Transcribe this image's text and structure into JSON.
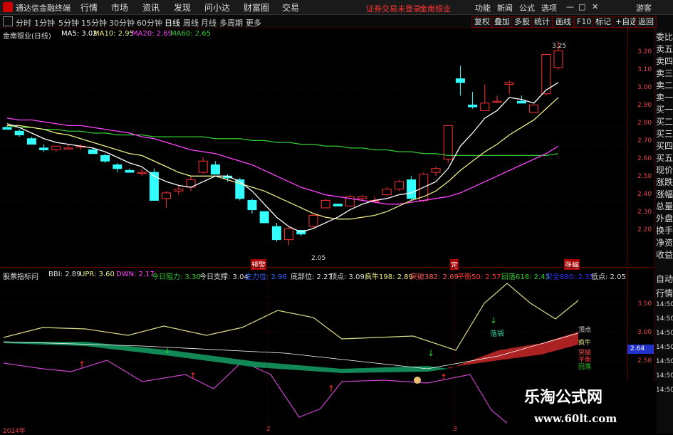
{
  "titlebar": {
    "app_title": "通达信金融终端",
    "menus": [
      "行情",
      "市场",
      "资讯",
      "发现",
      "问小达",
      "财富圈",
      "交易"
    ],
    "alert": "证券交易未登录",
    "stock_name": "金南银业",
    "right_menus": [
      "功能",
      "新闻",
      "公式",
      "选项"
    ],
    "window_controls": [
      "—",
      "□",
      "✕"
    ]
  },
  "toolbar": {
    "periods": [
      "分时",
      "1分钟",
      "5分钟",
      "15分钟",
      "30分钟",
      "60分钟",
      "日线",
      "周线",
      "月线",
      "多周期",
      "更多"
    ],
    "active_period": "日线",
    "right_buttons": [
      "复权",
      "叠加",
      "多股",
      "统计",
      "画线",
      "F10",
      "标记",
      "+自选",
      "返回"
    ],
    "far_right": "游客"
  },
  "main_legend": {
    "name": "金南银业(日线)",
    "ma5": "MA5: 3.02",
    "ma10": "MA10: 2.95",
    "ma20": "MA20: 2.69",
    "ma60": "MA60: 2.65"
  },
  "main_axis": [
    "3.20",
    "3.10",
    "3.00",
    "2.90",
    "2.80",
    "2.70",
    "2.60",
    "2.50",
    "2.40",
    "2.30",
    "2.20"
  ],
  "annotations": {
    "high": "3.25",
    "low": "2.05",
    "tag1": "预警",
    "tag2": "定",
    "tag3": "涨幅"
  },
  "sub_legend": {
    "name": "股票指标问",
    "bbi": "BBI: 2.89",
    "upr": "UPR: 3.60",
    "dwn": "DWN: 2.17",
    "resist": "今日阻力: 3.30",
    "support": "今日支撑: 3.04",
    "zhuli": "主力位: 2.96",
    "bottom": "底部位: 2.27",
    "top": "顶点: 3.09",
    "crazy": "疯牛198: 2.89",
    "break": "突破382: 2.69",
    "balance": "平衡50: 2.57",
    "pullback": "回落618: 2.45",
    "safe": "安全880: 2.35",
    "lowpt": "低点: 2.05"
  },
  "sub_axis": [
    "3.50",
    "3.00",
    "2.50"
  ],
  "sub_labels": {
    "topline": "顶点",
    "crazy": "疯牛",
    "l1": "突破",
    "l2": "平衡",
    "l3": "回落",
    "fall": "落袋",
    "current": "2.64"
  },
  "time_axis": [
    "2024年",
    "2",
    "3"
  ],
  "side_panel": [
    "委比",
    "卖五",
    "卖四",
    "卖三",
    "卖二",
    "卖一",
    "买一",
    "买二",
    "买三",
    "买四",
    "买五",
    "现价",
    "涨跌",
    "涨幅",
    "总量",
    "外盘",
    "换手",
    "净资",
    "收益"
  ],
  "side_panel2": [
    "自动",
    "行情",
    "14:50",
    "14:50",
    "14:50",
    "14:50",
    "14:50",
    "14:50",
    "14:50"
  ],
  "watermark": {
    "line1": "乐淘公式网",
    "line2": "www.60lt.com"
  },
  "colors": {
    "up": "#ff3333",
    "down": "#33ffff",
    "ma5": "#ffffff",
    "ma10": "#eeee88",
    "ma20": "#ff44ff",
    "ma60": "#33cc33",
    "bg": "#000000"
  },
  "chart_data": {
    "type": "candlestick",
    "candles": [
      [
        2.79,
        2.8,
        2.78,
        2.78
      ],
      [
        2.77,
        2.78,
        2.74,
        2.75
      ],
      [
        2.73,
        2.74,
        2.7,
        2.7
      ],
      [
        2.68,
        2.7,
        2.66,
        2.67
      ],
      [
        2.67,
        2.69,
        2.66,
        2.69
      ],
      [
        2.68,
        2.7,
        2.67,
        2.68
      ],
      [
        2.69,
        2.7,
        2.67,
        2.69
      ],
      [
        2.67,
        2.68,
        2.65,
        2.65
      ],
      [
        2.64,
        2.65,
        2.6,
        2.61
      ],
      [
        2.59,
        2.6,
        2.55,
        2.57
      ],
      [
        2.56,
        2.57,
        2.55,
        2.55
      ],
      [
        2.55,
        2.57,
        2.53,
        2.55
      ],
      [
        2.55,
        2.57,
        2.4,
        2.4
      ],
      [
        2.41,
        2.45,
        2.36,
        2.44
      ],
      [
        2.45,
        2.48,
        2.43,
        2.46
      ],
      [
        2.47,
        2.53,
        2.45,
        2.51
      ],
      [
        2.55,
        2.63,
        2.54,
        2.61
      ],
      [
        2.59,
        2.61,
        2.54,
        2.54
      ],
      [
        2.53,
        2.54,
        2.5,
        2.52
      ],
      [
        2.51,
        2.52,
        2.4,
        2.41
      ],
      [
        2.4,
        2.41,
        2.33,
        2.35
      ],
      [
        2.34,
        2.34,
        2.28,
        2.28
      ],
      [
        2.26,
        2.28,
        2.18,
        2.19
      ],
      [
        2.19,
        2.26,
        2.16,
        2.25
      ],
      [
        2.24,
        2.24,
        2.21,
        2.22
      ],
      [
        2.26,
        2.33,
        2.25,
        2.32
      ],
      [
        2.36,
        2.41,
        2.36,
        2.4
      ],
      [
        2.38,
        2.38,
        2.37,
        2.37
      ],
      [
        2.37,
        2.43,
        2.37,
        2.42
      ],
      [
        2.41,
        2.43,
        2.4,
        2.42
      ],
      [
        2.4,
        2.42,
        2.39,
        2.4
      ],
      [
        2.43,
        2.47,
        2.42,
        2.46
      ],
      [
        2.46,
        2.51,
        2.45,
        2.5
      ],
      [
        2.51,
        2.53,
        2.4,
        2.41
      ],
      [
        2.4,
        2.55,
        2.39,
        2.54
      ],
      [
        2.55,
        2.58,
        2.53,
        2.57
      ],
      [
        2.62,
        2.8,
        2.6,
        2.8
      ],
      [
        3.05,
        3.12,
        2.96,
        3.03
      ],
      [
        2.91,
        2.98,
        2.89,
        2.9
      ],
      [
        2.88,
        3.02,
        2.88,
        2.92
      ],
      [
        2.93,
        2.96,
        2.92,
        2.93
      ],
      [
        3.02,
        3.04,
        2.97,
        3.03
      ],
      [
        2.93,
        2.96,
        2.92,
        2.92
      ],
      [
        2.87,
        2.91,
        2.87,
        2.91
      ],
      [
        2.97,
        3.18,
        2.96,
        3.18
      ],
      [
        3.11,
        3.25,
        3.1,
        3.2
      ]
    ],
    "ma5": [
      2.81,
      2.79,
      2.76,
      2.73,
      2.71,
      2.7,
      2.69,
      2.68,
      2.66,
      2.63,
      2.6,
      2.58,
      2.53,
      2.5,
      2.48,
      2.47,
      2.5,
      2.53,
      2.53,
      2.5,
      2.45,
      2.38,
      2.31,
      2.26,
      2.23,
      2.25,
      2.28,
      2.31,
      2.35,
      2.38,
      2.4,
      2.41,
      2.43,
      2.44,
      2.47,
      2.5,
      2.57,
      2.69,
      2.76,
      2.84,
      2.88,
      2.95,
      2.94,
      2.92,
      2.99,
      3.03
    ],
    "ma10": [
      2.8,
      2.8,
      2.79,
      2.78,
      2.76,
      2.75,
      2.73,
      2.71,
      2.69,
      2.67,
      2.65,
      2.64,
      2.61,
      2.58,
      2.55,
      2.53,
      2.53,
      2.53,
      2.51,
      2.49,
      2.47,
      2.45,
      2.42,
      2.39,
      2.36,
      2.33,
      2.31,
      2.3,
      2.3,
      2.31,
      2.32,
      2.34,
      2.37,
      2.4,
      2.42,
      2.45,
      2.5,
      2.56,
      2.61,
      2.66,
      2.7,
      2.75,
      2.79,
      2.83,
      2.89,
      2.95
    ],
    "ma20": [
      2.84,
      2.83,
      2.83,
      2.82,
      2.81,
      2.8,
      2.8,
      2.79,
      2.78,
      2.77,
      2.76,
      2.74,
      2.73,
      2.71,
      2.69,
      2.67,
      2.66,
      2.65,
      2.63,
      2.61,
      2.59,
      2.56,
      2.53,
      2.5,
      2.47,
      2.45,
      2.43,
      2.42,
      2.41,
      2.4,
      2.39,
      2.38,
      2.38,
      2.39,
      2.4,
      2.41,
      2.42,
      2.44,
      2.47,
      2.5,
      2.53,
      2.56,
      2.59,
      2.62,
      2.65,
      2.69
    ],
    "ma60": [
      2.8,
      2.79,
      2.79,
      2.78,
      2.78,
      2.77,
      2.77,
      2.76,
      2.76,
      2.75,
      2.75,
      2.75,
      2.74,
      2.74,
      2.74,
      2.74,
      2.74,
      2.73,
      2.73,
      2.73,
      2.72,
      2.72,
      2.71,
      2.71,
      2.7,
      2.7,
      2.69,
      2.69,
      2.68,
      2.68,
      2.67,
      2.67,
      2.66,
      2.66,
      2.65,
      2.65,
      2.64,
      2.64,
      2.64,
      2.64,
      2.64,
      2.64,
      2.64,
      2.64,
      2.64,
      2.65
    ],
    "ylim": [
      2.12,
      3.3
    ]
  }
}
